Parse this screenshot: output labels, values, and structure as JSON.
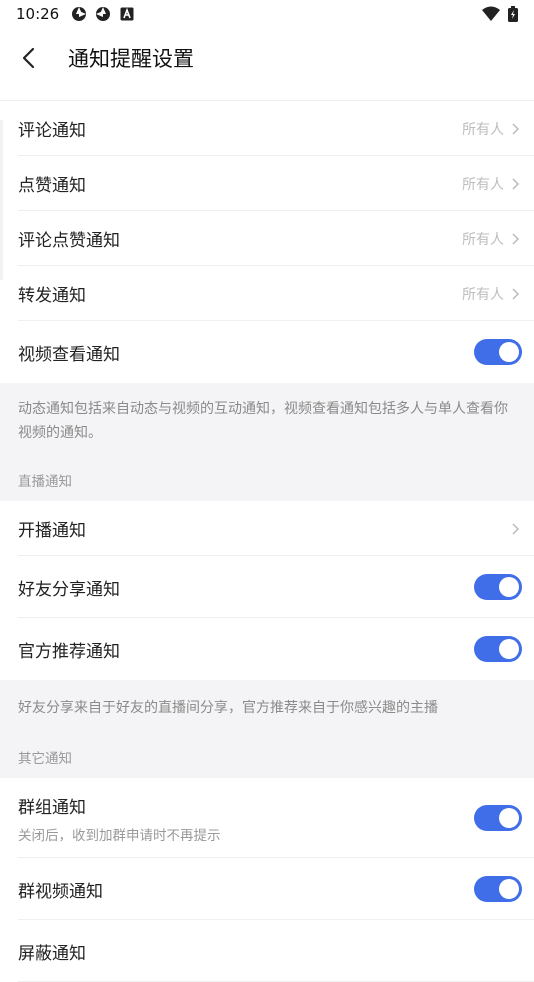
{
  "status": {
    "time": "10:26",
    "icons": [
      "aperture-icon",
      "aperture-icon",
      "a-box-icon"
    ],
    "right_icons": [
      "wifi-icon",
      "battery-icon"
    ]
  },
  "header": {
    "title": "通知提醒设置",
    "back_icon": "chevron-left-icon"
  },
  "dynamic": [
    {
      "label": "评论通知",
      "value": "所有人"
    },
    {
      "label": "点赞通知",
      "value": "所有人"
    },
    {
      "label": "评论点赞通知",
      "value": "所有人"
    },
    {
      "label": "转发通知",
      "value": "所有人"
    },
    {
      "label": "视频查看通知",
      "toggle": true
    }
  ],
  "note1": "动态通知包括来自动态与视频的互动通知，视频查看通知包括多人与单人查看你视频的通知。",
  "live": {
    "section": "直播通知",
    "items": [
      {
        "label": "开播通知"
      },
      {
        "label": "好友分享通知",
        "toggle": true
      },
      {
        "label": "官方推荐通知",
        "toggle": true
      }
    ]
  },
  "note2": "好友分享来自于好友的直播间分享，官方推荐来自于你感兴趣的主播",
  "other": {
    "section": "其它通知",
    "items": [
      {
        "label": "群组通知",
        "sub": "关闭后，收到加群申请时不再提示",
        "toggle": true
      },
      {
        "label": "群视频通知",
        "toggle": true
      },
      {
        "label": "屏蔽通知"
      }
    ]
  },
  "accent_color": "#3f6ee8"
}
